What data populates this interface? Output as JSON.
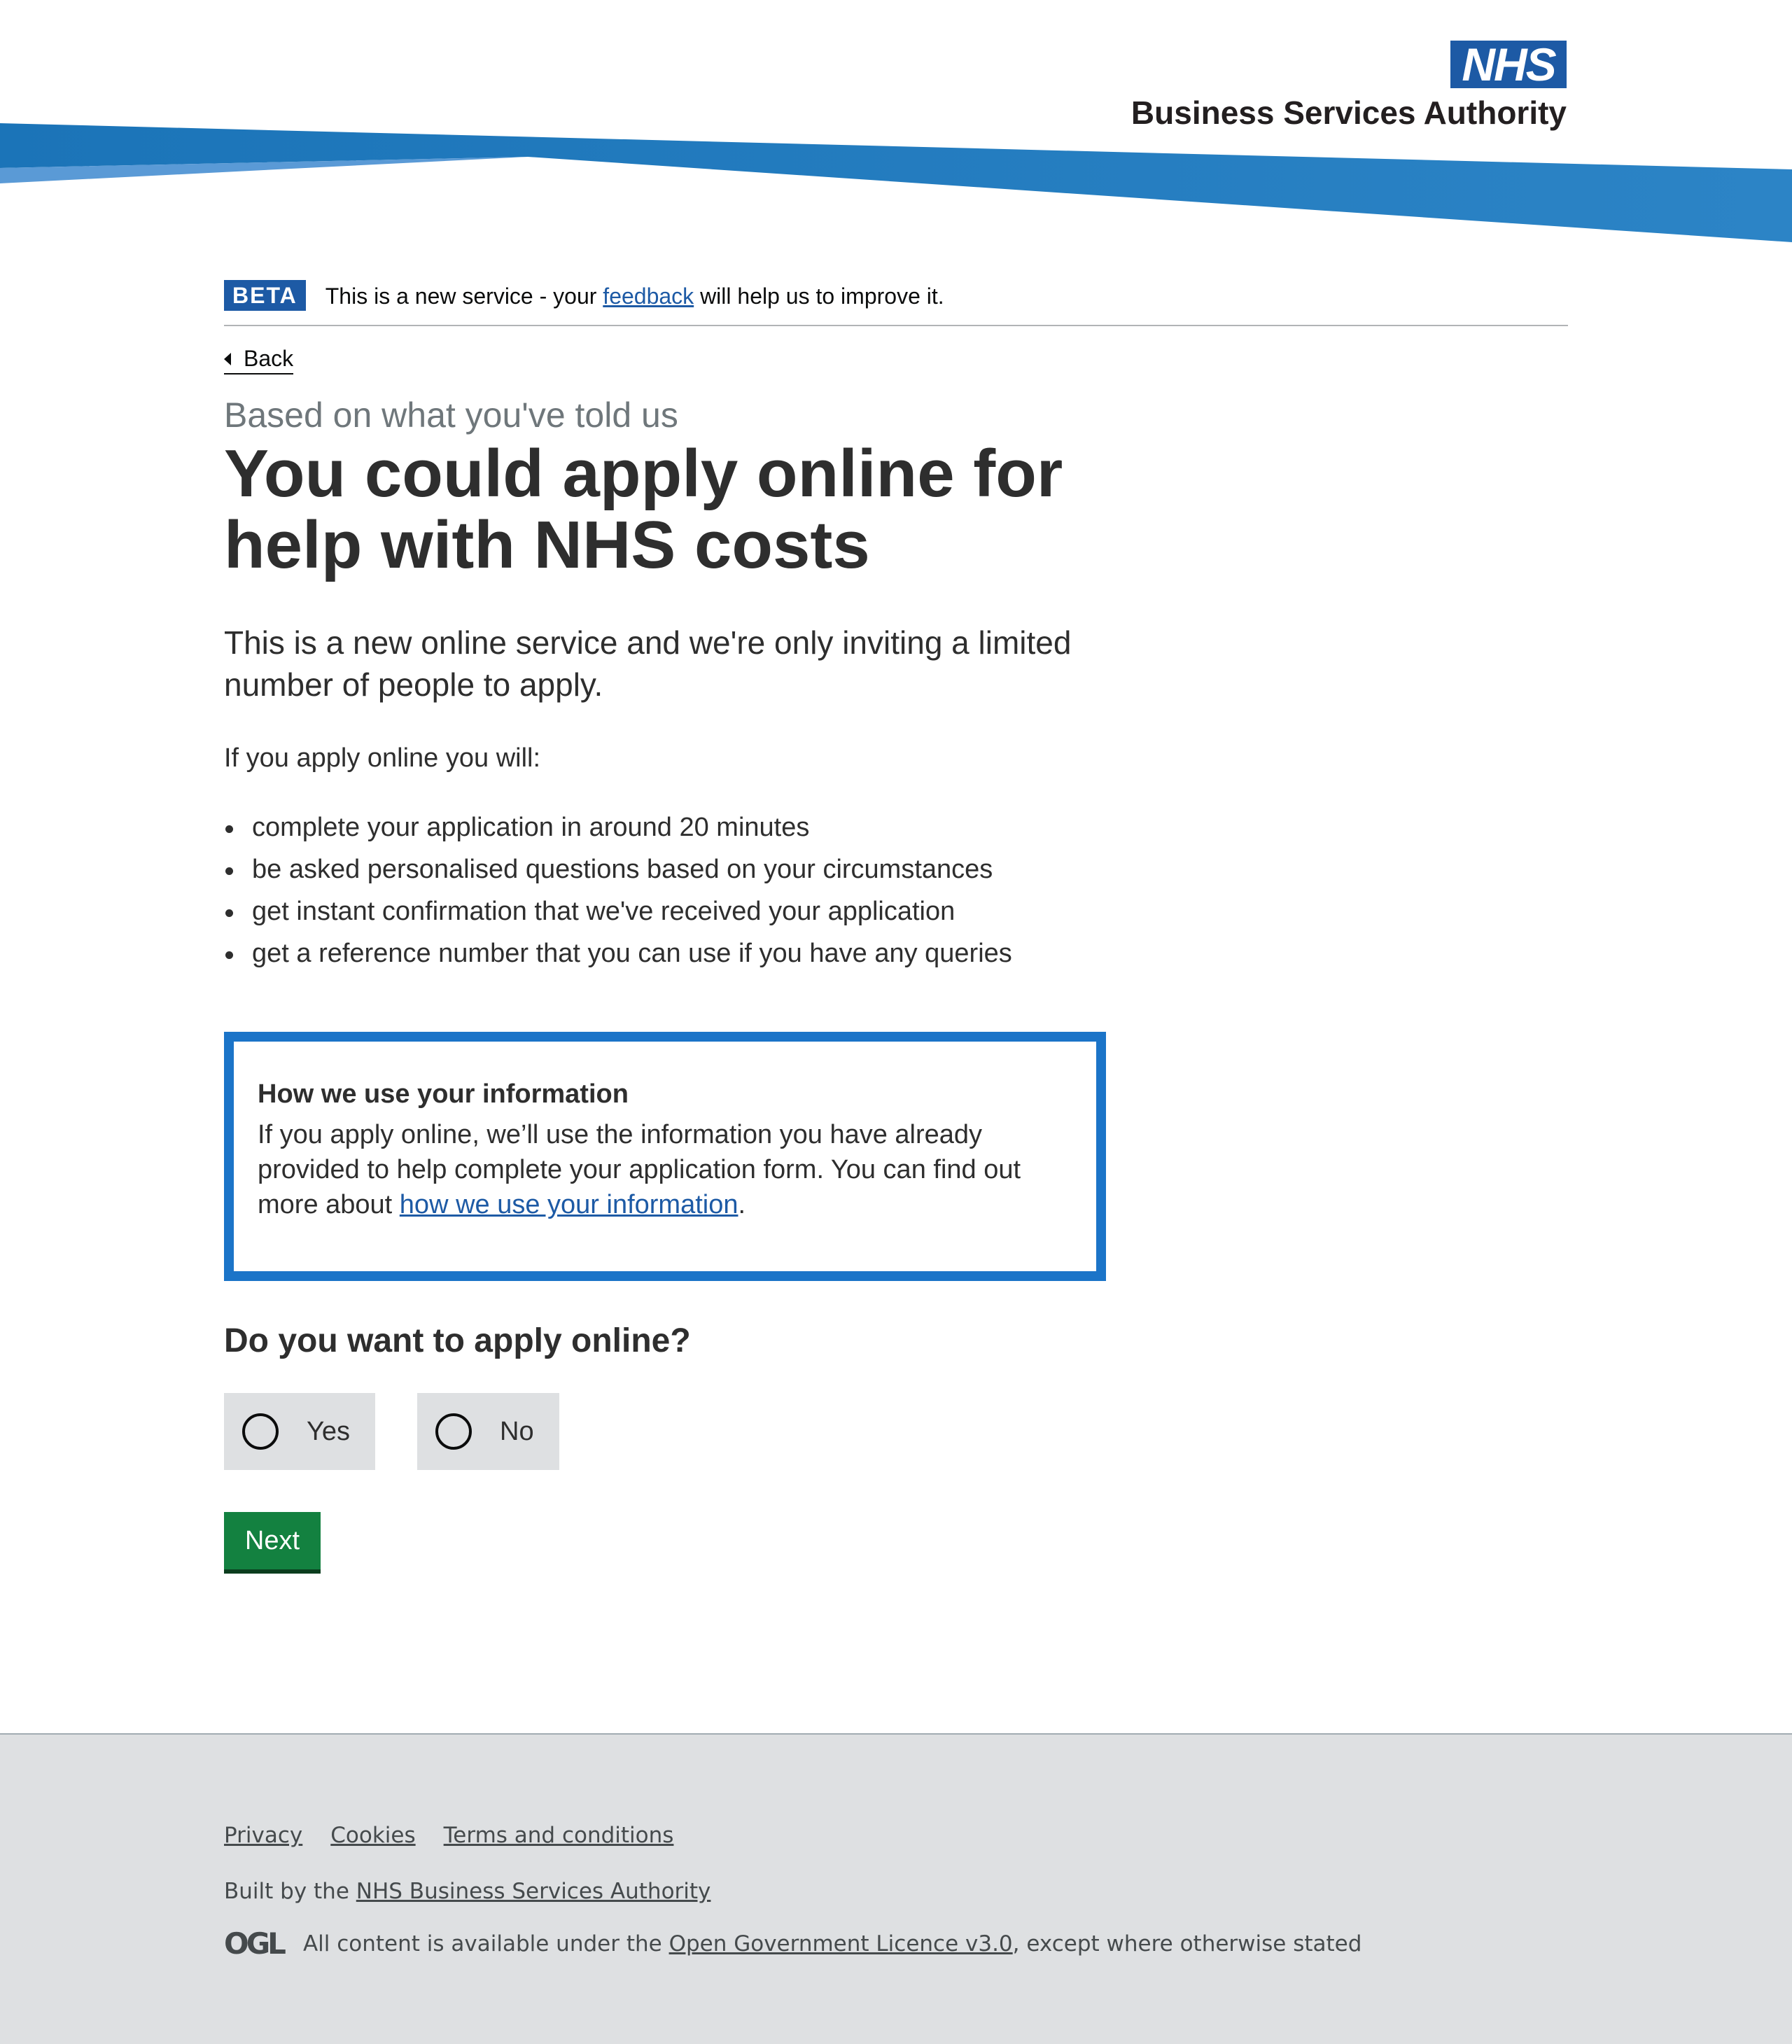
{
  "header": {
    "logo_text": "NHS",
    "org_name": "Business Services Authority",
    "colors": {
      "swoosh_dark": "#1b74b8",
      "swoosh_light": "#5a9ad6",
      "logo_blue": "#1d5aa5"
    }
  },
  "beta_banner": {
    "tag": "BETA",
    "text_before": "This is a new service - your ",
    "link": "feedback",
    "text_after": " will help us to improve it."
  },
  "back_link": {
    "label": "Back",
    "icon": "chevron-left-icon"
  },
  "main": {
    "caption": "Based on what you've told us",
    "title": "You could apply online for help with NHS costs",
    "lead": "This is a new online service and we're only inviting a limited number of people to apply.",
    "intro": "If you apply online you will:",
    "benefits": [
      "complete your application in around 20 minutes",
      "be asked personalised questions based on your circumstances",
      "get instant confirmation that we've received your application",
      "get a reference number that you can use if you have any queries"
    ]
  },
  "info_box": {
    "heading": "How we use your information",
    "body_before": "If you apply online, we’ll use the information you have already provided to help complete your application form. You can find out more about ",
    "link": "how we use your information",
    "body_after": ".",
    "border_color": "#1b74c8"
  },
  "question": {
    "legend": "Do you want to apply online?",
    "options": [
      {
        "label": "Yes"
      },
      {
        "label": "No"
      }
    ],
    "selected": null
  },
  "next_button": {
    "label": "Next",
    "color": "#138140"
  },
  "footer": {
    "links": [
      "Privacy",
      "Cookies",
      "Terms and conditions"
    ],
    "built_by_prefix": "Built by the ",
    "built_by_link": "NHS Business Services Authority",
    "ogl_logo": "OGL",
    "licence_prefix": "All content is available under the ",
    "licence_link": "Open Government Licence v3.0",
    "licence_suffix": ", except where otherwise stated"
  }
}
